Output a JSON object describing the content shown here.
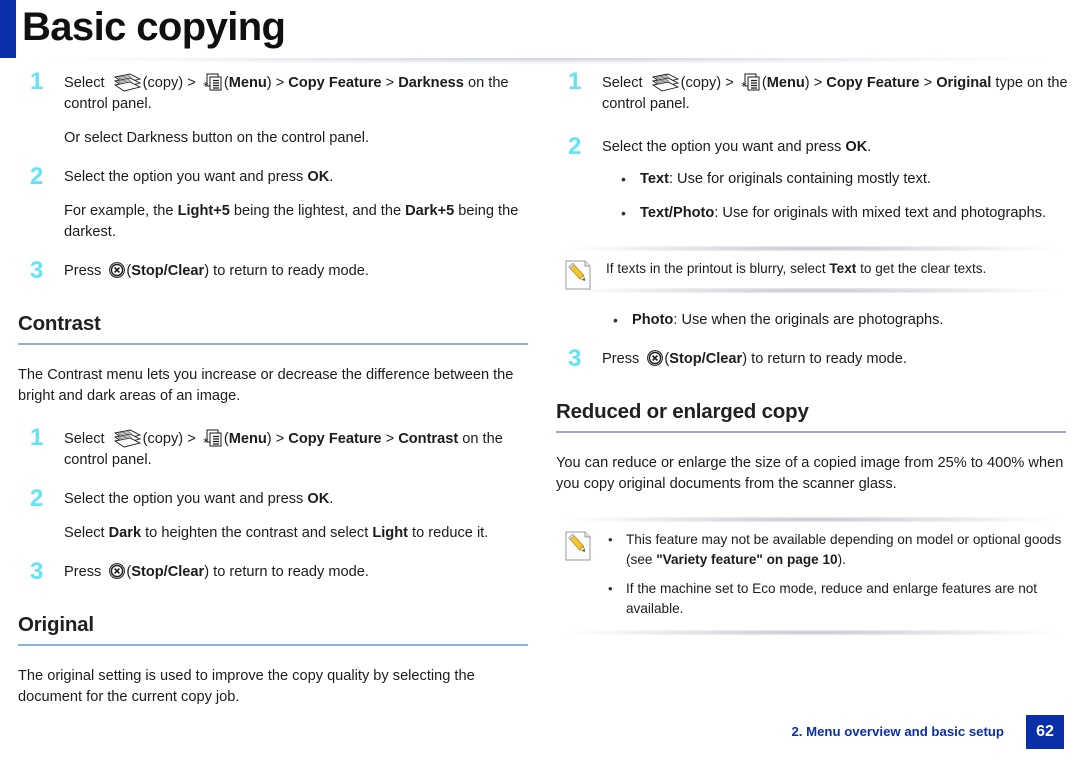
{
  "header": {
    "title": "Basic copying",
    "accent_color": "#0b2fa8"
  },
  "colors": {
    "step_number": "#63e3f5",
    "rule_blue": "#8ab4de",
    "rule_lavender": "#a9a3cf",
    "footer_blue": "#0b2fa8"
  },
  "icons": {
    "copy": "copy-icon",
    "menu": "menu-icon",
    "stop_clear": "stop-clear-icon",
    "note": "note-pencil-icon"
  },
  "left_column": {
    "darkness_steps": {
      "step1_num": "1",
      "step1_text_a": "Select ",
      "step1_copy_label": "(copy) > ",
      "step1_menu_label": "(",
      "step1_menu_bold": "Menu",
      "step1_text_b": ") > ",
      "step1_bold_feature": "Copy Feature",
      "step1_text_c": " > ",
      "step1_bold_target": "Darkness",
      "step1_text_d": " on the control panel.",
      "step1_sub": "Or select Darkness button on the control panel.",
      "step2_num": "2",
      "step2_text_a": "Select the option you want and press ",
      "step2_bold_ok": "OK",
      "step2_text_b": ".",
      "step2_sub_a": "For example, the ",
      "step2_sub_bold1": "Light+5",
      "step2_sub_b": " being the lightest, and the ",
      "step2_sub_bold2": "Dark+5",
      "step2_sub_c": " being the darkest.",
      "step3_num": "3",
      "step3_text_a": "Press ",
      "step3_text_b": "(",
      "step3_bold_stop": "Stop/Clear",
      "step3_text_c": ") to return to ready mode."
    },
    "contrast_section": {
      "heading": "Contrast",
      "intro": "The Contrast menu lets you increase or decrease the difference between the bright and dark areas of an image.",
      "step1_num": "1",
      "step1_text_a": "Select ",
      "step1_copy_label": "(copy) > ",
      "step1_menu_open": "(",
      "step1_menu_bold": "Menu",
      "step1_text_b": ") > ",
      "step1_bold_feature": "Copy Feature",
      "step1_text_c": " > ",
      "step1_bold_target": "Contrast",
      "step1_text_d": " on the control panel.",
      "step2_num": "2",
      "step2_text_a": "Select the option you want and press ",
      "step2_bold_ok": "OK",
      "step2_text_b": ".",
      "step2_sub_a": "Select ",
      "step2_sub_bold1": "Dark",
      "step2_sub_b": " to heighten the contrast and select ",
      "step2_sub_bold2": "Light",
      "step2_sub_c": " to reduce it.",
      "step3_num": "3",
      "step3_text_a": "Press ",
      "step3_text_b": "(",
      "step3_bold_stop": "Stop/Clear",
      "step3_text_c": ") to return to ready mode."
    },
    "original_section": {
      "heading": "Original",
      "intro": "The original setting is used to improve the copy quality by selecting the document for the current copy job."
    }
  },
  "right_column": {
    "original_steps": {
      "step1_num": "1",
      "step1_text_a": "Select ",
      "step1_copy_label": "(copy) > ",
      "step1_menu_open": "(",
      "step1_menu_bold": "Menu",
      "step1_text_b": ") > ",
      "step1_bold_feature": "Copy Feature",
      "step1_text_c": " > ",
      "step1_bold_target": "Original",
      "step1_text_d": " type on the control panel.",
      "step2_num": "2",
      "step2_text_a": "Select the option you want and press ",
      "step2_bold_ok": "OK",
      "step2_text_b": ".",
      "bullet1_bold": "Text",
      "bullet1_text": ": Use for originals containing mostly text.",
      "bullet2_bold": "Text/Photo",
      "bullet2_text": ": Use for originals with mixed text and photographs.",
      "bullet3_bold": "Photo",
      "bullet3_text": ": Use when the originals are photographs.",
      "step3_num": "3",
      "step3_text_a": "Press ",
      "step3_text_b": "(",
      "step3_bold_stop": "Stop/Clear",
      "step3_text_c": ") to return to ready mode."
    },
    "note_blurry": {
      "text_a": "If texts in the printout is blurry, select ",
      "bold": "Text",
      "text_b": " to get the clear texts."
    },
    "reduced_section": {
      "heading": "Reduced or enlarged copy",
      "intro": "You can reduce or enlarge the size of a copied image from 25% to 400% when you copy original documents from the scanner glass.",
      "note_bullet1_a": "This feature may not be available depending on model or optional goods (see ",
      "note_bullet1_bold": "\"Variety feature\" on page 10",
      "note_bullet1_b": ").",
      "note_bullet2": "If the machine set to Eco mode, reduce and enlarge features are not available."
    }
  },
  "footer": {
    "section_label": "2.  Menu overview and basic setup",
    "page_number": "62"
  }
}
